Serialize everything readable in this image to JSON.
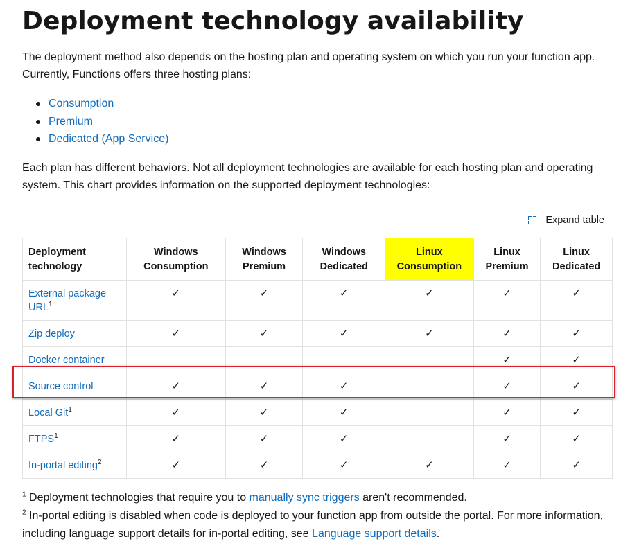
{
  "title": "Deployment technology availability",
  "intro": "The deployment method also depends on the hosting plan and operating system on which you run your function app. Currently, Functions offers three hosting plans:",
  "plans": [
    "Consumption",
    "Premium",
    "Dedicated (App Service)"
  ],
  "behaviors": "Each plan has different behaviors. Not all deployment technologies are available for each hosting plan and operating system. This chart provides information on the supported deployment technologies:",
  "expand_label": "Expand table",
  "table": {
    "headers": [
      "Deployment technology",
      "Windows Consumption",
      "Windows Premium",
      "Windows Dedicated",
      "Linux Consumption",
      "Linux Premium",
      "Linux Dedicated"
    ],
    "highlighted_column": "Linux Consumption",
    "highlight_color": "#ffff00",
    "rows": [
      {
        "name": "External package URL",
        "note": "1",
        "cells": [
          "✓",
          "✓",
          "✓",
          "✓",
          "✓",
          "✓"
        ]
      },
      {
        "name": "Zip deploy",
        "note": "",
        "cells": [
          "✓",
          "✓",
          "✓",
          "✓",
          "✓",
          "✓"
        ]
      },
      {
        "name": "Docker container",
        "note": "",
        "cells": [
          "",
          "",
          "",
          "",
          "✓",
          "✓"
        ]
      },
      {
        "name": "Source control",
        "note": "",
        "cells": [
          "✓",
          "✓",
          "✓",
          "",
          "✓",
          "✓"
        ]
      },
      {
        "name": "Local Git",
        "note": "1",
        "cells": [
          "✓",
          "✓",
          "✓",
          "",
          "✓",
          "✓"
        ]
      },
      {
        "name": "FTPS",
        "note": "1",
        "cells": [
          "✓",
          "✓",
          "✓",
          "",
          "✓",
          "✓"
        ]
      },
      {
        "name": "In-portal editing",
        "note": "2",
        "cells": [
          "✓",
          "✓",
          "✓",
          "✓",
          "✓",
          "✓"
        ]
      }
    ],
    "boxed_row": "Source control",
    "box_color": "#d9202a"
  },
  "footnotes": {
    "fn1": {
      "num": "1",
      "pre": " Deployment technologies that require you to ",
      "link": "manually sync triggers",
      "post": " aren't recommended."
    },
    "fn2": {
      "num": "2",
      "pre": " In-portal editing is disabled when code is deployed to your function app from outside the portal. For more information, including language support details for in-portal editing, see ",
      "link": "Language support details",
      "post": "."
    }
  },
  "colors": {
    "link": "#0f6cbd",
    "text": "#171717"
  }
}
